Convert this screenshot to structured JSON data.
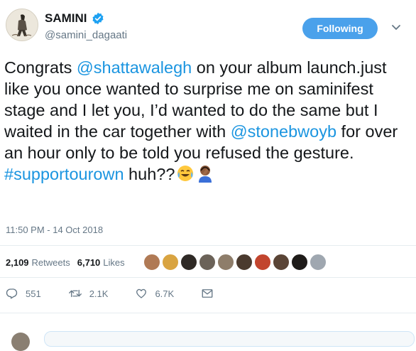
{
  "user": {
    "display_name": "SAMINI",
    "handle": "@samini_dagaati",
    "verified_icon": "verified-badge-icon"
  },
  "follow_button": {
    "label": "Following"
  },
  "tweet": {
    "part1": "Congrats ",
    "mention1": "@shattawalegh",
    "part2": " on your album launch.just like you once wanted to surprise me on saminifest stage and I let you, I’d wanted to do the same but I waited in the car together with ",
    "mention2": "@stonebwoyb",
    "part3": " for over an hour only to be told you refused the gesture. ",
    "hashtag": "#supportourown",
    "part4": " huh??",
    "emojis": [
      "face-with-tears-of-joy-icon",
      "person-facepalming-icon"
    ]
  },
  "timestamp": "11:50 PM - 14 Oct 2018",
  "stats": {
    "retweets_count": "2,109",
    "retweets_label": "Retweets",
    "likes_count": "6,710",
    "likes_label": "Likes"
  },
  "actions": {
    "replies": "551",
    "retweets": "2.1K",
    "likes": "6.7K"
  },
  "colors": {
    "link": "#1b95e0",
    "follow_bg": "#4aa1eb",
    "muted": "#657786"
  }
}
